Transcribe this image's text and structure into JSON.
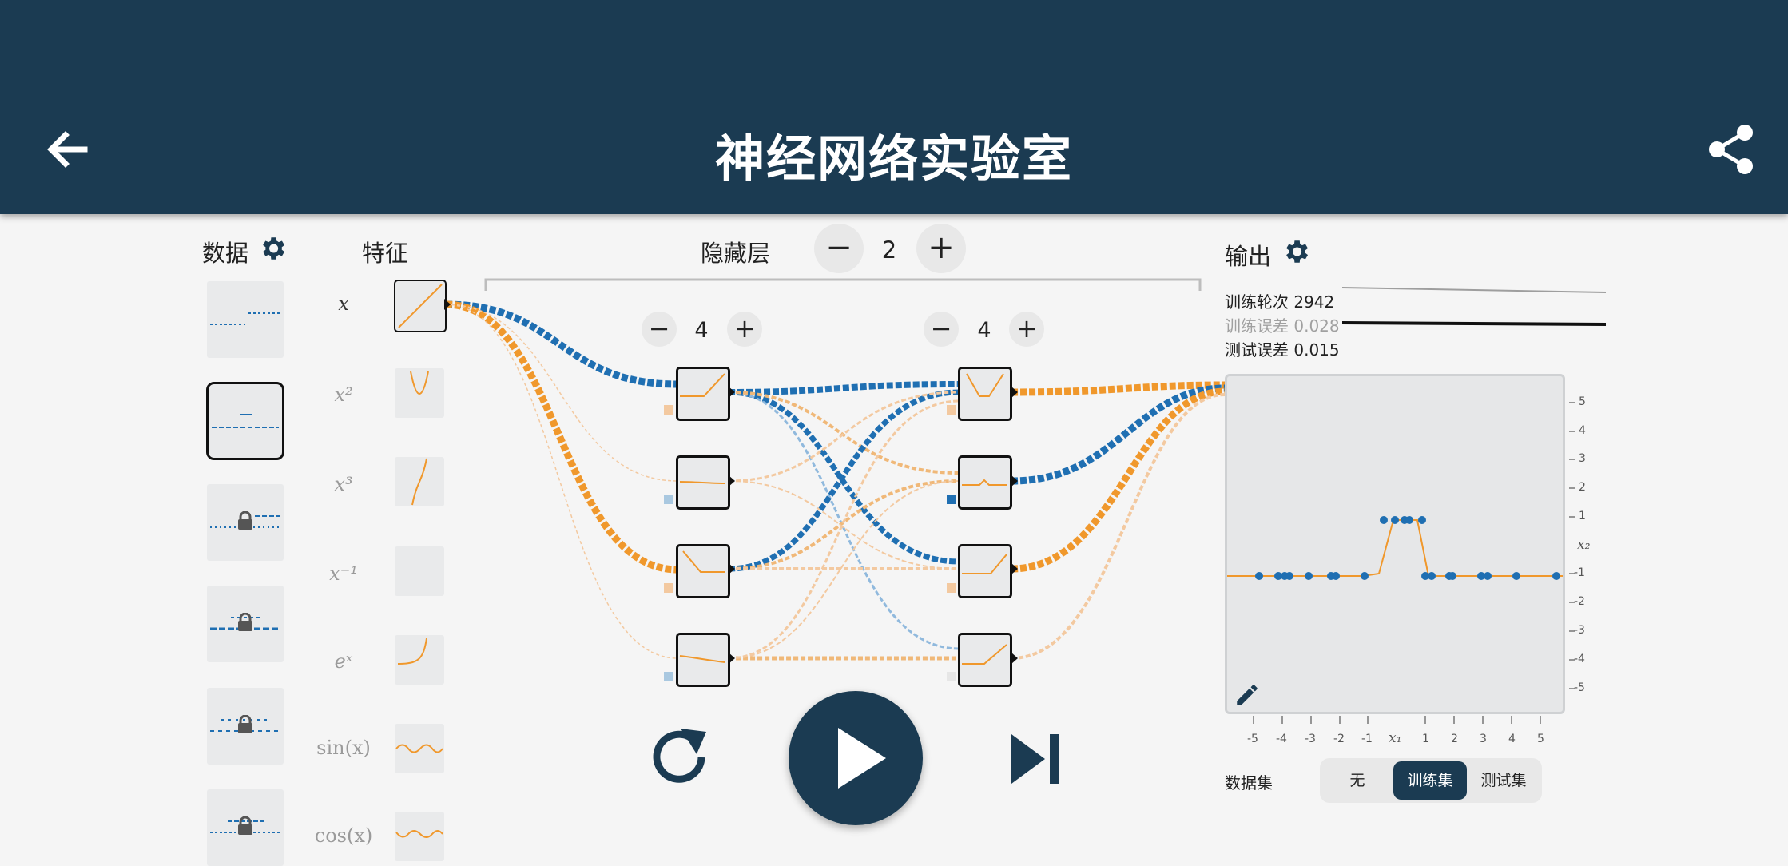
{
  "header": {
    "title": "神经网络实验室",
    "back_icon": "arrow-back-icon",
    "share_icon": "share-icon",
    "background": "#1b3b52"
  },
  "data_section": {
    "label": "数据"
  },
  "features_section": {
    "label": "特征",
    "items": [
      "x",
      "x²",
      "x³",
      "x⁻¹",
      "eˣ",
      "sin(x)",
      "cos(x)"
    ]
  },
  "hidden_layers": {
    "label": "隐藏层",
    "count": "2",
    "minus": "−",
    "plus": "+"
  },
  "layers": [
    {
      "neurons": "4",
      "minus": "−",
      "plus": "+"
    },
    {
      "neurons": "4",
      "minus": "−",
      "plus": "+"
    }
  ],
  "output": {
    "label": "输出",
    "epoch_label": "训练轮次",
    "epoch": "2942",
    "train_loss_label": "训练误差",
    "train_loss": "0.028",
    "test_loss_label": "测试误差",
    "test_loss": "0.015",
    "x_axis_label": "x₁",
    "y_axis_label": "x₂",
    "x_ticks": [
      "-5",
      "-4",
      "-3",
      "-2",
      "-1",
      "x₁",
      "1",
      "2",
      "3",
      "4",
      "5"
    ],
    "y_ticks": [
      "5",
      "4",
      "3",
      "2",
      "1",
      "x₂",
      "-1",
      "-2",
      "-3",
      "-4",
      "-5"
    ]
  },
  "dataset_toggle": {
    "label": "数据集",
    "options": [
      "无",
      "训练集",
      "测试集"
    ],
    "selected": "训练集"
  },
  "colors": {
    "positive": "#1f6fb2",
    "negative": "#f0982c",
    "dark": "#1b3b52"
  }
}
